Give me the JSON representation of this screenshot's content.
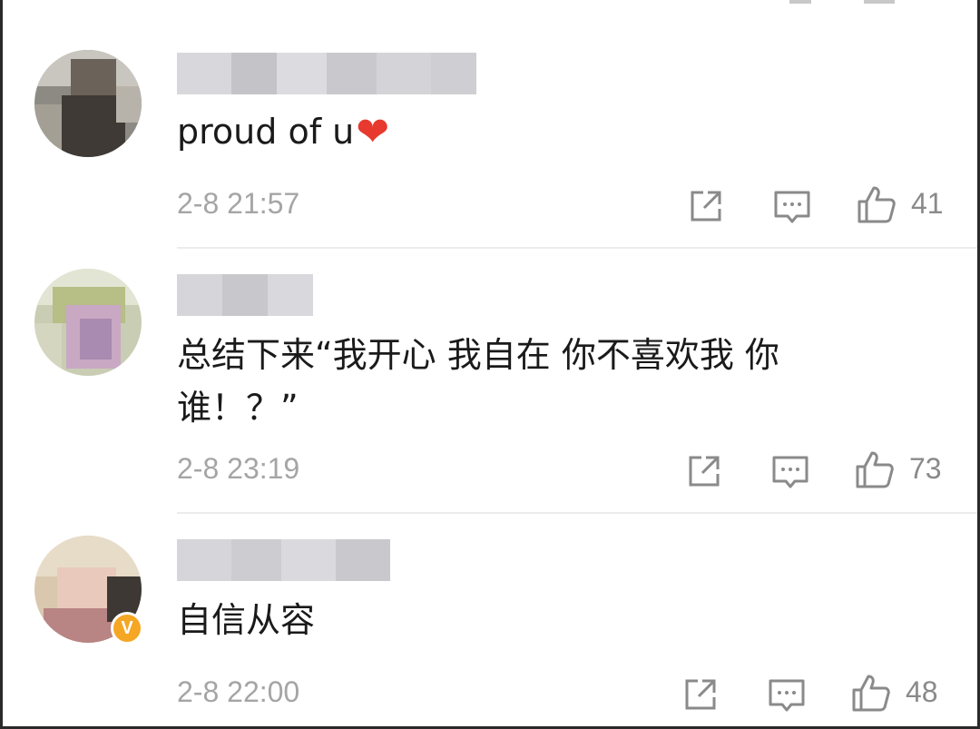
{
  "comments": [
    {
      "text": "proud of u",
      "emoji": "❤",
      "timestamp": "2-8 21:57",
      "likes": "41",
      "verified": false
    },
    {
      "text_line1": "总结下来“我开心 我自在 你不喜欢我 你",
      "text_line2": "谁！？”",
      "timestamp": "2-8 23:19",
      "likes": "73",
      "verified": false
    },
    {
      "text": "自信从容",
      "timestamp": "2-8 22:00",
      "likes": "48",
      "verified": true,
      "verified_badge": "V"
    }
  ],
  "icons": {
    "share": "share-icon",
    "reply": "comment-icon",
    "like": "thumbs-up-icon"
  },
  "colors": {
    "text": "#1a1a1a",
    "meta": "#a5a5a5",
    "icon": "#8a8a8a",
    "heart": "#e8392e",
    "verified": "#f5a623"
  }
}
